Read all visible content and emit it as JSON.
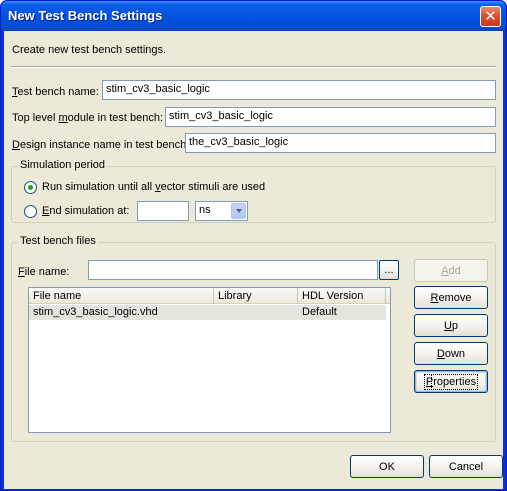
{
  "window": {
    "title": "New Test Bench Settings",
    "close_glyph": "✕"
  },
  "description": "Create new test bench settings.",
  "fields": {
    "test_bench_name": {
      "label_underline": "T",
      "label_rest": "est bench name:",
      "value": "stim_cv3_basic_logic"
    },
    "top_level_module": {
      "label_pre": "Top level ",
      "label_underline": "m",
      "label_rest": "odule in test bench:",
      "value": "stim_cv3_basic_logic"
    },
    "design_instance": {
      "label_underline": "D",
      "label_rest": "esign instance name in test bench:",
      "value": "the_cv3_basic_logic"
    }
  },
  "simulation_period": {
    "legend": "Simulation period",
    "run_until": {
      "label_pre": "Run simulation until all ",
      "label_underline": "v",
      "label_rest": "ector stimuli are used",
      "selected": true
    },
    "end_at": {
      "label_underline": "E",
      "label_rest": "nd simulation at:",
      "selected": false,
      "value": "",
      "unit": "ns"
    }
  },
  "test_bench_files": {
    "legend": "Test bench files",
    "file_name_label_underline": "F",
    "file_name_label_rest": "ile name:",
    "file_name_value": "",
    "browse_label": "...",
    "add_label_underline": "A",
    "add_label_rest": "dd",
    "columns": [
      "File name",
      "Library",
      "HDL Version"
    ],
    "rows": [
      {
        "file_name": "stim_cv3_basic_logic.vhd",
        "library": "",
        "hdl_version": "Default"
      }
    ],
    "remove_label_underline": "R",
    "remove_label_rest": "emove",
    "up_label_underline": "U",
    "up_label_rest": "p",
    "down_label_underline": "D",
    "down_label_rest": "own",
    "properties_label_underline": "P",
    "properties_label_rest": "roperties"
  },
  "footer": {
    "ok_label": "OK",
    "cancel_label": "Cancel"
  }
}
